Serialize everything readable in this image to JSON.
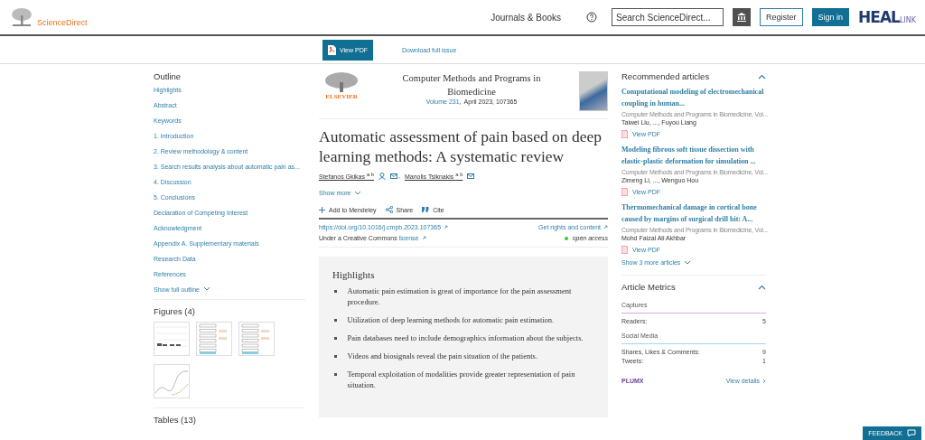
{
  "header": {
    "brand": "ScienceDirect",
    "journals_link": "Journals & Books",
    "search": {
      "placeholder": "Search ScienceDirect..."
    },
    "register": "Register",
    "sign_in": "Sign in",
    "partner_logo": {
      "big": "HEAL",
      "small": "LINK"
    }
  },
  "article_bar": {
    "view_pdf": "View PDF",
    "download": "Download full issue"
  },
  "outline": {
    "title": "Outline",
    "items": [
      "Highlights",
      "Abstract",
      "Keywords",
      "1. Introduction",
      "2. Review methodology & content",
      "3. Search results analysis about automatic pain as...",
      "4. Discussion",
      "5. Conclusions",
      "Declaration of Competing Interest",
      "Acknowledgment",
      "Appendix A. Supplementary materials",
      "Research Data",
      "References"
    ],
    "show_full": "Show full outline"
  },
  "figures": {
    "title": "Figures (4)",
    "thumbnails": [
      {
        "kind": "bar"
      },
      {
        "kind": "flow"
      },
      {
        "kind": "flow"
      },
      {
        "kind": "line"
      }
    ]
  },
  "tables": {
    "title": "Tables (13)"
  },
  "journal": {
    "publisher": "ELSEVIER",
    "name": "Computer Methods and Programs in Biomedicine",
    "volume": "Volume 231",
    "separator": ",",
    "issue": "April 2023, 107365"
  },
  "article": {
    "title": "Automatic assessment of pain based on deep learning methods: A systematic review",
    "authors": [
      {
        "name": "Stefanos Gkikas",
        "affil": "a b",
        "corresponding": true
      },
      {
        "name": "Manolis Tsiknakis",
        "affil": "a b",
        "corresponding": false
      }
    ],
    "author_separator": ",",
    "show_more": "Show more",
    "actions": [
      "Add to Mendeley",
      "Share",
      "Cite"
    ],
    "doi": "https://doi.org/10.1016/j.cmpb.2023.107365",
    "rights": "Get rights and content",
    "license_prefix": "Under a Creative Commons ",
    "license_link": "license",
    "open_access": "open access"
  },
  "highlights": {
    "title": "Highlights",
    "items": [
      "Automatic pain estimation is great of importance for the pain assessment procedure.",
      "Utilization of deep learning methods for automatic pain estimation.",
      "Pain databases need to include demographics information about the subjects.",
      "Videos and biosignals reveal the pain situation of the patients.",
      "Temporal exploitation of modalities provide greater representation of pain situation."
    ]
  },
  "recommended": {
    "title": "Recommended articles",
    "expanded": true,
    "items": [
      {
        "title": "Computational modeling of electromechanical coupling in human...",
        "source": "Computer Methods and Programs in Biomedicine, Vol...",
        "authors": "Taiwei Liu, ..., Fuyou Liang",
        "pdf": "View PDF"
      },
      {
        "title": "Modeling fibrous soft tissue dissection with elastic-plastic deformation for simulation ...",
        "source": "Computer Methods and Programs in Biomedicine, Vol...",
        "authors": "Zimeng Li, ..., Wenguo Hou",
        "pdf": "View PDF"
      },
      {
        "title": "Thermomechanical damage in cortical bone caused by margins of surgical drill bit: A...",
        "source": "Computer Methods and Programs in Biomedicine, Vol...",
        "authors": "Mohd Faizal Ali Akhbar",
        "pdf": "View PDF"
      }
    ],
    "show_more": "Show 3 more articles"
  },
  "metrics": {
    "title": "Article Metrics",
    "expanded": true,
    "groups": [
      {
        "name": "Captures",
        "color": "#d9a6e8",
        "rows": [
          {
            "label": "Readers:",
            "value": "5"
          }
        ]
      },
      {
        "name": "Social Media",
        "color": "#9fd8ee",
        "rows": [
          {
            "label": "Shares, Likes & Comments:",
            "value": "9"
          },
          {
            "label": "Tweets:",
            "value": "1"
          }
        ]
      }
    ],
    "plumx": "PLUMX",
    "view_details": "View details"
  },
  "feedback": "FEEDBACK"
}
